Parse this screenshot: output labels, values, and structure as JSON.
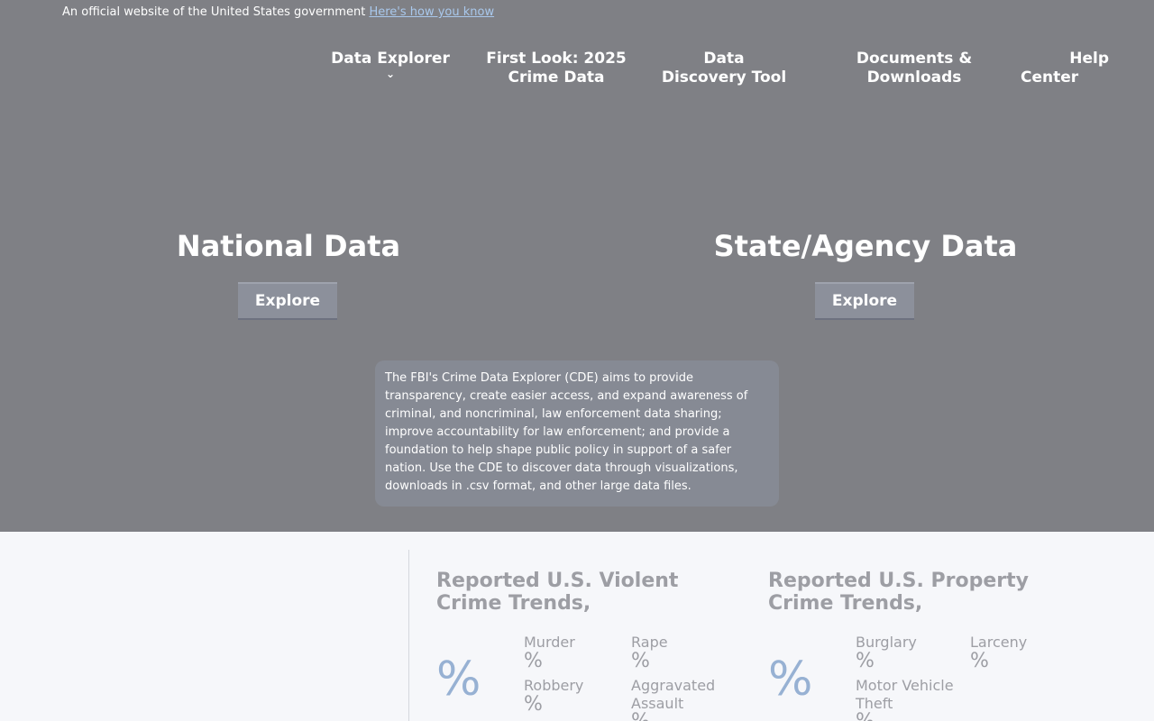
{
  "banner": {
    "text": "An official website of the United States government",
    "link": "Here's how you know"
  },
  "nav": {
    "data_explorer": "Data Explorer",
    "first_look_line1": "First Look: 2025",
    "first_look_line2": "Crime Data",
    "ddt_line1": "Data",
    "ddt_line2": "Discovery Tool",
    "docs_line1": "Documents &",
    "docs_line2": "Downloads",
    "help_line1": "Help",
    "help_line2": "Center"
  },
  "national": {
    "title": "National Data",
    "button": "Explore"
  },
  "state": {
    "title": "State/Agency Data",
    "button": "Explore"
  },
  "about_text": "The FBI's Crime Data Explorer (CDE) aims to provide transparency, create easier access, and expand awareness of criminal, and noncriminal, law enforcement data sharing; improve accountability for law enforcement; and provide a foundation to help shape public policy in support of a safer nation. Use the CDE to discover data through visualizations, downloads in .csv format, and other large data files.",
  "violent": {
    "title": "Reported U.S. Violent Crime Trends,",
    "total_pct": "%",
    "murder": {
      "label": "Murder",
      "pct": "%"
    },
    "rape": {
      "label": "Rape",
      "pct": "%"
    },
    "robbery": {
      "label": "Robbery",
      "pct": "%"
    },
    "aggravated_assault": {
      "label_line1": "Aggravated",
      "label_line2": "Assault",
      "pct": "%"
    }
  },
  "property": {
    "title": "Reported U.S. Property Crime Trends,",
    "total_pct": "%",
    "burglary": {
      "label": "Burglary",
      "pct": "%"
    },
    "larceny": {
      "label": "Larceny",
      "pct": "%"
    },
    "mvt": {
      "label_line1": "Motor Vehicle",
      "label_line2": "Theft",
      "pct": "%"
    }
  },
  "colors": {
    "hero_bg": "#7f8085",
    "link": "#a9c8ec",
    "button_bg": "#8c909b",
    "about_bg": "#868a94",
    "pct_accent": "#97b1d3",
    "muted_text": "#9d9ea4",
    "page_bg": "#f6f7fa"
  }
}
